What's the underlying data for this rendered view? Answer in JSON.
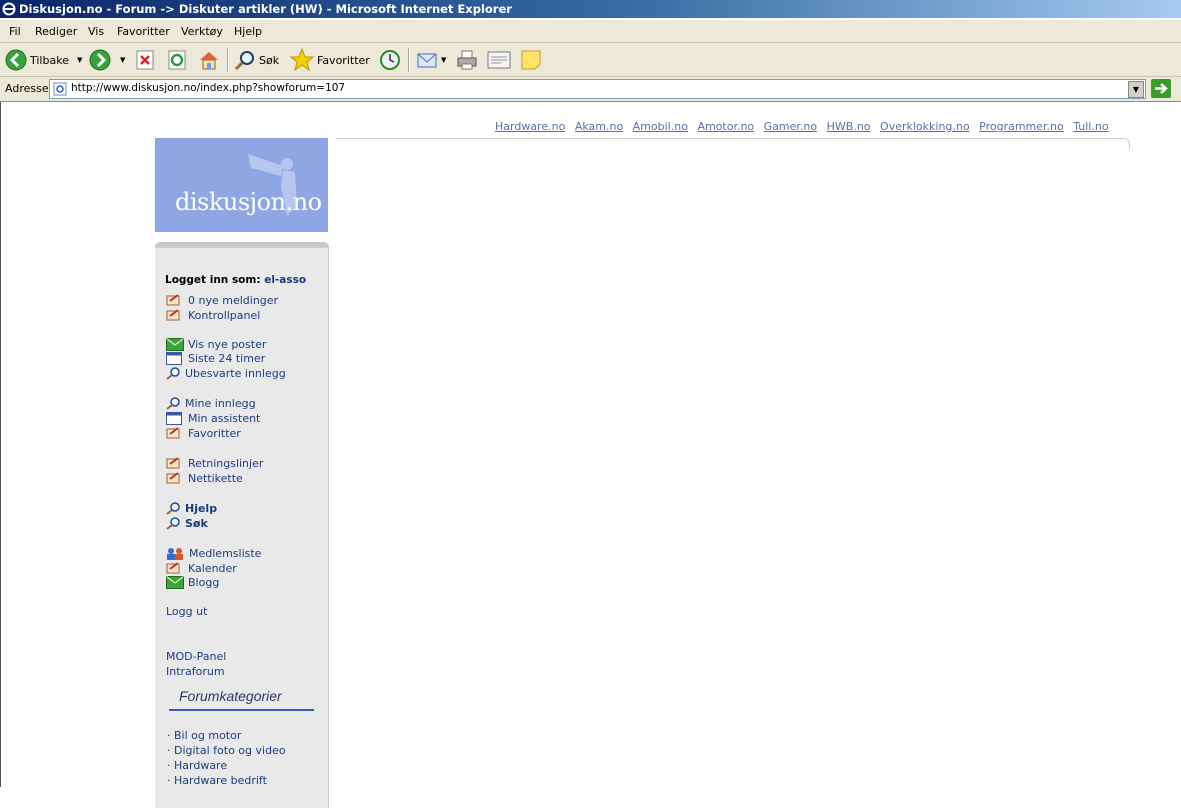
{
  "window": {
    "title": "Diskusjon.no - Forum -> Diskuter artikler (HW) - Microsoft Internet Explorer"
  },
  "menu": [
    "Fil",
    "Rediger",
    "Vis",
    "Favoritter",
    "Verktøy",
    "Hjelp"
  ],
  "toolbar": {
    "back_label": "Tilbake",
    "search_label": "Søk",
    "favorites_label": "Favoritter"
  },
  "address": {
    "label": "Adresse",
    "url": "http://www.diskusjon.no/index.php?showforum=107"
  },
  "top_links": [
    "Hardware.no",
    "Akam.no",
    "Amobil.no",
    "Amotor.no",
    "Gamer.no",
    "HWB.no",
    "Overklokking.no",
    "Programmer.no",
    "Tull.no"
  ],
  "logo": {
    "text": "diskusjon.no"
  },
  "sidebar": {
    "logged_in_label": "Logget inn som:",
    "username": "el-asso",
    "items": [
      {
        "label": "0 nye meldinger",
        "icon": "note-icon"
      },
      {
        "label": "Kontrollpanel",
        "icon": "note-icon"
      },
      {
        "label": "Vis nye poster",
        "icon": "envelope-icon"
      },
      {
        "label": "Siste 24 timer",
        "icon": "window-icon"
      },
      {
        "label": "Ubesvarte innlegg",
        "icon": "magnifier-icon"
      },
      {
        "label": "Mine innlegg",
        "icon": "magnifier-icon"
      },
      {
        "label": "Min assistent",
        "icon": "window-icon"
      },
      {
        "label": "Favoritter",
        "icon": "note-icon"
      },
      {
        "label": "Retningslinjer",
        "icon": "note-icon"
      },
      {
        "label": "Nettikette",
        "icon": "note-icon"
      },
      {
        "label": "Hjelp",
        "icon": "magnifier-icon"
      },
      {
        "label": "Søk",
        "icon": "magnifier-icon"
      },
      {
        "label": "Medlemsliste",
        "icon": "people-icon"
      },
      {
        "label": "Kalender",
        "icon": "note-icon"
      },
      {
        "label": "Blogg",
        "icon": "envelope-icon"
      }
    ],
    "logout": "Logg ut",
    "mod_panel": "MOD-Panel",
    "intraforum": "Intraforum",
    "forum_categories_title": "Forumkategorier",
    "categories": [
      "· Bil og motor",
      "· Digital foto og video",
      "· Hardware",
      "· Hardware bedrift"
    ]
  }
}
